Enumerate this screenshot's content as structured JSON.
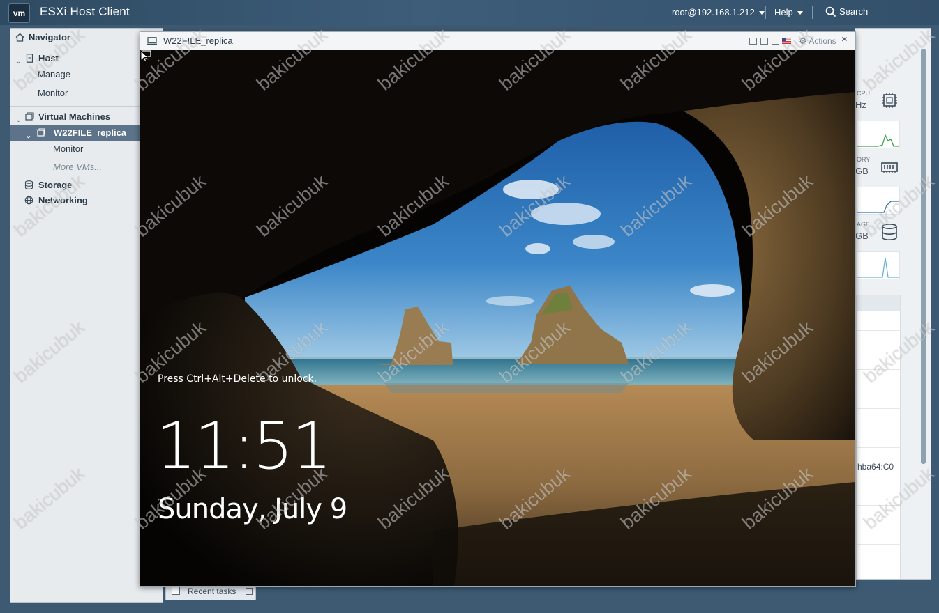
{
  "topbar": {
    "logo": "vm",
    "title": "ESXi Host Client",
    "user": "root@192.168.1.212",
    "help": "Help",
    "search": "Search"
  },
  "navigator": {
    "title": "Navigator",
    "host": "Host",
    "manage": "Manage",
    "monitor": "Monitor",
    "virtual_machines": "Virtual Machines",
    "vm_name": "W22FILE_replica",
    "vm_monitor": "Monitor",
    "more_vms": "More VMs...",
    "storage": "Storage",
    "networking": "Networking"
  },
  "background_panel": {
    "cpu_label": "CPU",
    "cpu_value": "Hz",
    "memory_label": "ORY",
    "memory_value": "GB",
    "storage_label": "AGE",
    "storage_value": "GB",
    "row_value": "hba64:C0"
  },
  "recent_tasks": {
    "label": "Recent tasks"
  },
  "console": {
    "title": "W22FILE_replica",
    "actions": "Actions",
    "close": "×",
    "unlock_text": "Press Ctrl+Alt+Delete to unlock.",
    "time": "11:51",
    "date": "Sunday, July 9"
  },
  "watermark": {
    "text": "bakicubuk"
  },
  "colors": {
    "topbar": "#33506a",
    "nav_selected": "#5c7389",
    "desktop": "#3e5a72"
  }
}
